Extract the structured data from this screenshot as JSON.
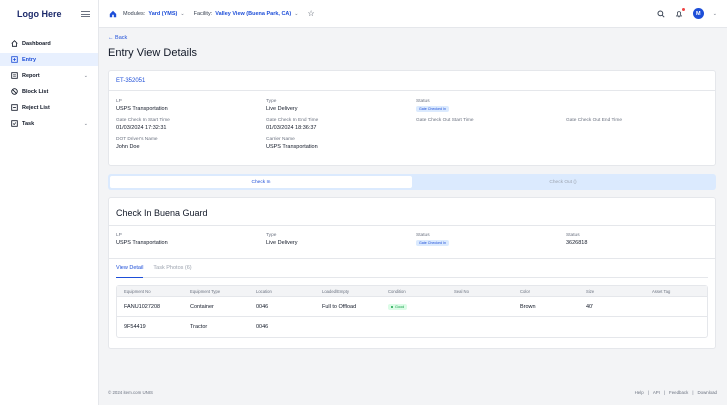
{
  "sidebar": {
    "logo": "Logo Here",
    "items": [
      {
        "label": "Dashboard",
        "icon": "home-icon",
        "has_chevron": false
      },
      {
        "label": "Entry",
        "icon": "entry-icon",
        "has_chevron": false,
        "active": true
      },
      {
        "label": "Report",
        "icon": "report-icon",
        "has_chevron": true
      },
      {
        "label": "Block List",
        "icon": "block-icon",
        "has_chevron": false
      },
      {
        "label": "Reject List",
        "icon": "reject-icon",
        "has_chevron": false
      },
      {
        "label": "Task",
        "icon": "task-icon",
        "has_chevron": true
      }
    ],
    "chevron": "⌄"
  },
  "topbar": {
    "modules_label": "Modules:",
    "modules_value": "Yard (YMS)",
    "facility_label": "Facility:",
    "facility_value": "Valley View (Buena Park, CA)",
    "chevron": "⌄",
    "star": "☆",
    "avatar_initial": "M"
  },
  "page": {
    "back": "← Back",
    "title": "Entry View Details"
  },
  "entry": {
    "id": "ET-352051",
    "fields": [
      {
        "label": "LP",
        "value": "USPS Transportation"
      },
      {
        "label": "Type",
        "value": "Live Delivery"
      },
      {
        "label": "Status",
        "value": "Gate Checked In",
        "chip": true
      },
      {
        "label": "",
        "value": ""
      },
      {
        "label": "Gate Check In Start Time",
        "value": "01/03/2024 17:32:31"
      },
      {
        "label": "Gate Check In End Time",
        "value": "01/03/2024 18:36:37"
      },
      {
        "label": "Gate Check Out Start Time",
        "value": ""
      },
      {
        "label": "Gate Check Out End Time",
        "value": ""
      },
      {
        "label": "DOT Driver's Name",
        "value": "John Doe"
      },
      {
        "label": "Carrier Name",
        "value": "USPS Transportation"
      }
    ]
  },
  "segments": {
    "check_in": "Check In",
    "check_out": "Check Out ()"
  },
  "checkin": {
    "title": "Check In  Buena Guard",
    "fields": [
      {
        "label": "LP",
        "value": "USPS Transportation"
      },
      {
        "label": "Type",
        "value": "Live Delivery"
      },
      {
        "label": "Status",
        "value": "Gate Checked In",
        "chip": true
      },
      {
        "label": "Status",
        "value": "3626818"
      }
    ]
  },
  "detail_tabs": {
    "view_detail": "View Detail",
    "task_photos": "Task Photos (6)"
  },
  "table": {
    "headers": [
      "Equipment No",
      "Equipment Type",
      "Location",
      "Loaded/Empty",
      "Condition",
      "Seal No",
      "Color",
      "Size",
      "Asset Tag"
    ],
    "rows": [
      [
        "FANU1027208",
        "Container",
        "0046",
        "Full to Offload",
        "Good",
        "",
        "Brown",
        "40'",
        ""
      ],
      [
        "9F54419",
        "Tractor",
        "0046",
        "",
        "",
        "",
        "",
        "",
        ""
      ]
    ]
  },
  "footer": {
    "copyright": "© 2024 item.com UNIS",
    "links": [
      "Help",
      "|",
      "API",
      "|",
      "Feedback",
      "|",
      "Download"
    ]
  },
  "colors": {
    "accent": "#1d4ed8",
    "status_chip_bg": "#dbeafe",
    "good_chip": "#16a34a"
  }
}
